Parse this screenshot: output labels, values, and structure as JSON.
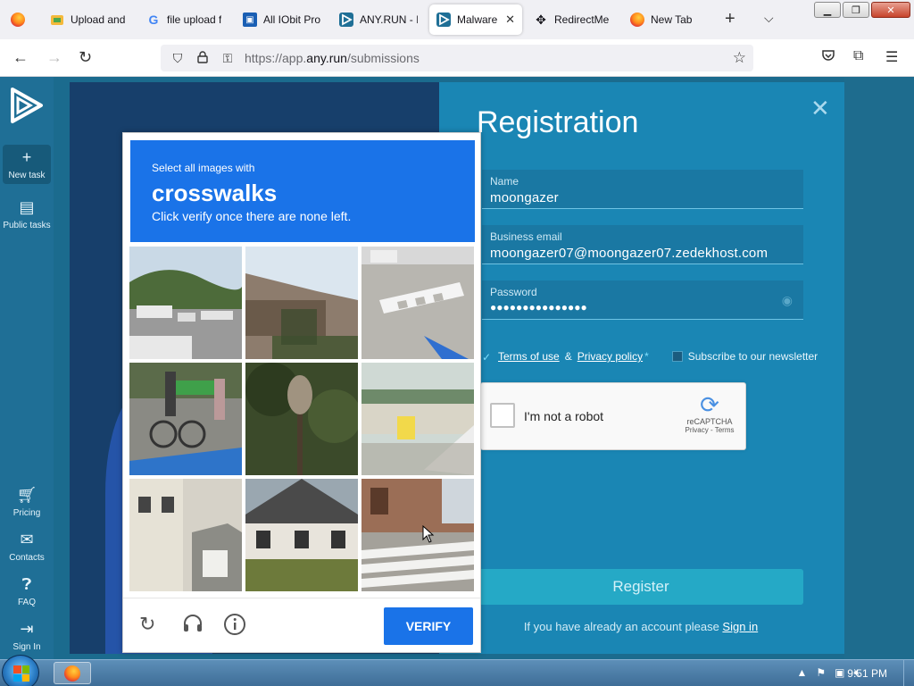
{
  "browser": {
    "tabs": [
      {
        "label": "",
        "icon": "firefox-icon"
      },
      {
        "label": "Upload and",
        "icon": "upload-icon"
      },
      {
        "label": "file upload f",
        "icon": "google-icon"
      },
      {
        "label": "All IObit Pro",
        "icon": "iobit-icon"
      },
      {
        "label": "ANY.RUN - I",
        "icon": "anyrun-icon"
      },
      {
        "label": "Malware",
        "icon": "anyrun-icon",
        "active": true
      },
      {
        "label": "RedirectMe",
        "icon": "redirect-icon"
      },
      {
        "label": "New Tab",
        "icon": "firefox-icon"
      }
    ],
    "url_prefix": "https://app.",
    "url_domain": "any.run",
    "url_path": "/submissions"
  },
  "sidebar": {
    "new_task": "New task",
    "public_tasks": "Public tasks",
    "pricing": "Pricing",
    "contacts": "Contacts",
    "faq": "FAQ",
    "sign_in": "Sign In"
  },
  "registration": {
    "title": "Registration",
    "name_label": "Name",
    "name_value": "moongazer",
    "email_label": "Business email",
    "email_value": "moongazer07@moongazer07.zedekhost.com",
    "password_label": "Password",
    "password_value": "●●●●●●●●●●●●●●●",
    "terms_of_use": "Terms of use",
    "amp": "&",
    "privacy_policy": "Privacy policy",
    "required_mark": "*",
    "newsletter": "Subscribe to our newsletter",
    "register": "Register",
    "have_account": "If you have already an account please",
    "sign_in": "Sign in"
  },
  "recaptcha": {
    "checkbox_label": "I'm not a robot",
    "brand": "reCAPTCHA",
    "links": "Privacy - Terms"
  },
  "challenge": {
    "line1": "Select all images with",
    "keyword": "crosswalks",
    "line3": "Click verify once there are none left.",
    "verify": "VERIFY"
  },
  "taskbar": {
    "time": "9:51 PM"
  }
}
